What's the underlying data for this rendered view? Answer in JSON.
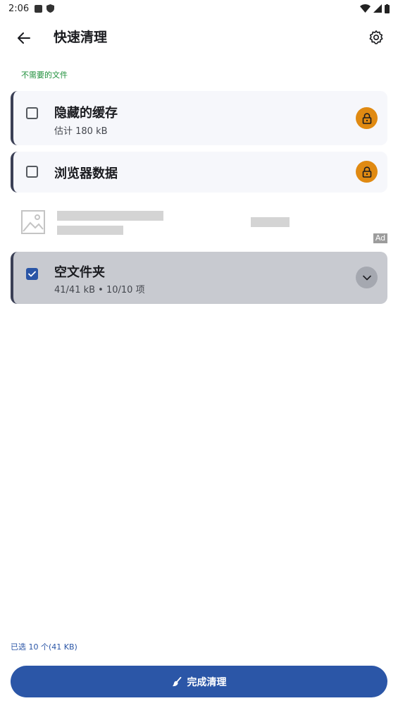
{
  "status_bar": {
    "time": "2:06"
  },
  "app_bar": {
    "title": "快速清理"
  },
  "section_label": "不需要的文件",
  "items": [
    {
      "title": "隐藏的缓存",
      "subtitle": "估计 180 kB",
      "checked": false,
      "locked": true
    },
    {
      "title": "浏览器数据",
      "checked": false,
      "locked": true
    },
    {
      "title": "空文件夹",
      "subtitle": "41/41 kB • 10/10 项",
      "checked": true,
      "locked": false
    }
  ],
  "ad": {
    "tag": "Ad"
  },
  "footer": {
    "selection_summary": "已选 10 个(41 KB)",
    "primary_button": "完成清理"
  },
  "colors": {
    "accent": "#2b56a7",
    "lock": "#e08a12",
    "section": "#1e8f3a"
  }
}
